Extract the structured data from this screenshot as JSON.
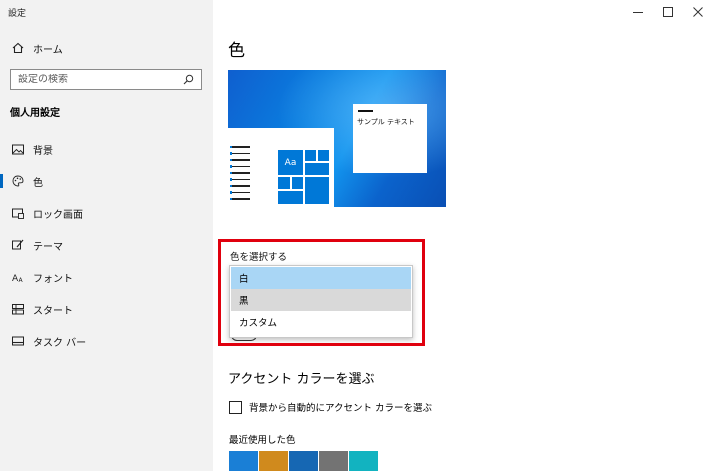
{
  "window": {
    "title": "設定",
    "controls": {
      "minimize": "—",
      "maximize": "☐",
      "close": "✕"
    }
  },
  "sidebar": {
    "home_label": "ホーム",
    "search_placeholder": "設定の検索",
    "section_heading": "個人用設定",
    "items": [
      {
        "label": "背景",
        "icon": "picture-icon"
      },
      {
        "label": "色",
        "icon": "palette-icon",
        "selected": true
      },
      {
        "label": "ロック画面",
        "icon": "lock-screen-icon"
      },
      {
        "label": "テーマ",
        "icon": "theme-brush-icon"
      },
      {
        "label": "フォント",
        "icon": "font-icon"
      },
      {
        "label": "スタート",
        "icon": "start-icon"
      },
      {
        "label": "タスク バー",
        "icon": "taskbar-icon"
      }
    ]
  },
  "main": {
    "title": "色",
    "preview": {
      "tile_text": "Aa",
      "sample_text": "サンプル テキスト"
    },
    "choose_color": {
      "label": "色を選択する",
      "options": [
        {
          "label": "白",
          "state": "highlighted"
        },
        {
          "label": "黒",
          "state": "hover"
        },
        {
          "label": "カスタム",
          "state": "normal"
        }
      ]
    },
    "accent": {
      "heading": "アクセント カラーを選ぶ",
      "auto_checkbox_label": "背景から自動的にアクセント カラーを選ぶ",
      "auto_checked": false,
      "recent_label": "最近使用した色",
      "recent_colors": [
        "#1a7fd6",
        "#d08a1d",
        "#1667b3",
        "#737373",
        "#12b3c0"
      ]
    }
  },
  "colors": {
    "accent": "#0078d7",
    "highlight_box": "#e0000e",
    "sidebar_bg": "#f2f2f2"
  }
}
